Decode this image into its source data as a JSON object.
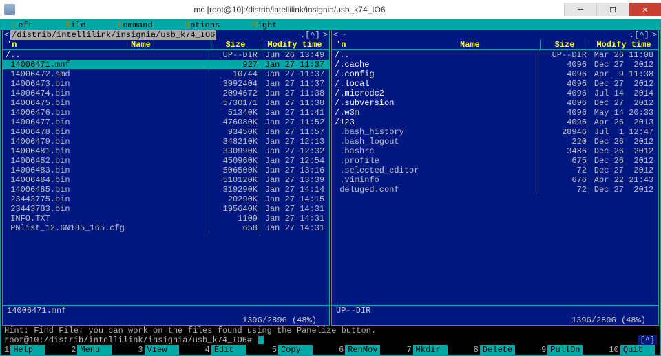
{
  "window": {
    "title": "mc [root@10]:/distrib/intellilink/insignia/usb_k74_IO6",
    "minimize_icon": "minimize-icon",
    "maximize_icon": "maximize-icon",
    "close_icon": "close-icon"
  },
  "menubar": {
    "items": [
      {
        "hot": "L",
        "rest": "eft"
      },
      {
        "hot": "F",
        "rest": "ile"
      },
      {
        "hot": "C",
        "rest": "ommand"
      },
      {
        "hot": "O",
        "rest": "ptions"
      },
      {
        "hot": "R",
        "rest": "ight"
      }
    ]
  },
  "left_pane": {
    "arrow_left": "<",
    "arrow_right": ">",
    "path": "/distrib/intellilink/insignia/usb_k74_IO6",
    "updots": ".[^]",
    "sort_mark": "'n",
    "headers": {
      "name": "Name",
      "size": "Size",
      "mtime": "Modify time"
    },
    "rows": [
      {
        "name": "/..",
        "size": "UP--DIR",
        "time": "Jun 26 13:49",
        "dir": true,
        "sel": false
      },
      {
        "name": " 14006471.mnf",
        "size": "927",
        "time": "Jan 27 11:37",
        "dir": false,
        "sel": true
      },
      {
        "name": " 14006472.smd",
        "size": "10744",
        "time": "Jan 27 11:37",
        "dir": false,
        "sel": false
      },
      {
        "name": " 14006473.bin",
        "size": "3992404",
        "time": "Jan 27 11:37",
        "dir": false,
        "sel": false
      },
      {
        "name": " 14006474.bin",
        "size": "2094672",
        "time": "Jan 27 11:38",
        "dir": false,
        "sel": false
      },
      {
        "name": " 14006475.bin",
        "size": "5730171",
        "time": "Jan 27 11:38",
        "dir": false,
        "sel": false
      },
      {
        "name": " 14006476.bin",
        "size": "51340K",
        "time": "Jan 27 11:41",
        "dir": false,
        "sel": false
      },
      {
        "name": " 14006477.bin",
        "size": "476080K",
        "time": "Jan 27 11:52",
        "dir": false,
        "sel": false
      },
      {
        "name": " 14006478.bin",
        "size": "93450K",
        "time": "Jan 27 11:57",
        "dir": false,
        "sel": false
      },
      {
        "name": " 14006479.bin",
        "size": "348210K",
        "time": "Jan 27 12:13",
        "dir": false,
        "sel": false
      },
      {
        "name": " 14006481.bin",
        "size": "330990K",
        "time": "Jan 27 12:32",
        "dir": false,
        "sel": false
      },
      {
        "name": " 14006482.bin",
        "size": "450960K",
        "time": "Jan 27 12:54",
        "dir": false,
        "sel": false
      },
      {
        "name": " 14006483.bin",
        "size": "506500K",
        "time": "Jan 27 13:16",
        "dir": false,
        "sel": false
      },
      {
        "name": " 14006484.bin",
        "size": "510120K",
        "time": "Jan 27 13:39",
        "dir": false,
        "sel": false
      },
      {
        "name": " 14006485.bin",
        "size": "319290K",
        "time": "Jan 27 14:14",
        "dir": false,
        "sel": false
      },
      {
        "name": " 23443775.bin",
        "size": "20290K",
        "time": "Jan 27 14:15",
        "dir": false,
        "sel": false
      },
      {
        "name": " 23443783.bin",
        "size": "195640K",
        "time": "Jan 27 14:31",
        "dir": false,
        "sel": false
      },
      {
        "name": " INFO.TXT",
        "size": "1109",
        "time": "Jan 27 14:31",
        "dir": false,
        "sel": false
      },
      {
        "name": " PNlist_12.6N185_165.cfg",
        "size": "658",
        "time": "Jan 27 14:31",
        "dir": false,
        "sel": false
      }
    ],
    "footer_status": "14006471.mnf",
    "disk": "139G/289G (48%)"
  },
  "right_pane": {
    "arrow_left": "<",
    "arrow_right": ">",
    "path": "~",
    "updots": ".[^]",
    "sort_mark": "'n",
    "headers": {
      "name": "Name",
      "size": "Size",
      "mtime": "Modify time"
    },
    "rows": [
      {
        "name": "/..",
        "size": "UP--DIR",
        "time": "Mar 26 11:08",
        "dir": true,
        "sel": false
      },
      {
        "name": "/.cache",
        "size": "4096",
        "time": "Dec 27  2012",
        "dir": true,
        "sel": false
      },
      {
        "name": "/.config",
        "size": "4096",
        "time": "Apr  9 11:38",
        "dir": true,
        "sel": false
      },
      {
        "name": "/.local",
        "size": "4096",
        "time": "Dec 27  2012",
        "dir": true,
        "sel": false
      },
      {
        "name": "/.microdc2",
        "size": "4096",
        "time": "Jul 14  2014",
        "dir": true,
        "sel": false
      },
      {
        "name": "/.subversion",
        "size": "4096",
        "time": "Dec 27  2012",
        "dir": true,
        "sel": false
      },
      {
        "name": "/.w3m",
        "size": "4096",
        "time": "May 14 20:33",
        "dir": true,
        "sel": false
      },
      {
        "name": "/123",
        "size": "4096",
        "time": "Apr 26  2013",
        "dir": true,
        "sel": false
      },
      {
        "name": " .bash_history",
        "size": "28946",
        "time": "Jul  1 12:47",
        "dir": false,
        "sel": false
      },
      {
        "name": " .bash_logout",
        "size": "220",
        "time": "Dec 26  2012",
        "dir": false,
        "sel": false
      },
      {
        "name": " .bashrc",
        "size": "3486",
        "time": "Dec 26  2012",
        "dir": false,
        "sel": false
      },
      {
        "name": " .profile",
        "size": "675",
        "time": "Dec 26  2012",
        "dir": false,
        "sel": false
      },
      {
        "name": " .selected_editor",
        "size": "72",
        "time": "Dec 27  2012",
        "dir": false,
        "sel": false
      },
      {
        "name": " .viminfo",
        "size": "676",
        "time": "Apr 22 21:43",
        "dir": false,
        "sel": false
      },
      {
        "name": " deluged.conf",
        "size": "72",
        "time": "Dec 27  2012",
        "dir": false,
        "sel": false
      }
    ],
    "footer_status": "UP--DIR",
    "disk": "139G/289G (48%)"
  },
  "hint": "Hint: Find File: you can work on the files found using the Panelize button.",
  "prompt": "root@10:/distrib/intellilink/insignia/usb_k74_IO6#",
  "prompt_up": "[^]",
  "bottom": {
    "keys": [
      {
        "n": "1",
        "l": "Help"
      },
      {
        "n": "2",
        "l": "Menu"
      },
      {
        "n": "3",
        "l": "View"
      },
      {
        "n": "4",
        "l": "Edit"
      },
      {
        "n": "5",
        "l": "Copy"
      },
      {
        "n": "6",
        "l": "RenMov"
      },
      {
        "n": "7",
        "l": "Mkdir"
      },
      {
        "n": "8",
        "l": "Delete"
      },
      {
        "n": "9",
        "l": "PullDn"
      },
      {
        "n": "10",
        "l": "Quit"
      }
    ]
  }
}
